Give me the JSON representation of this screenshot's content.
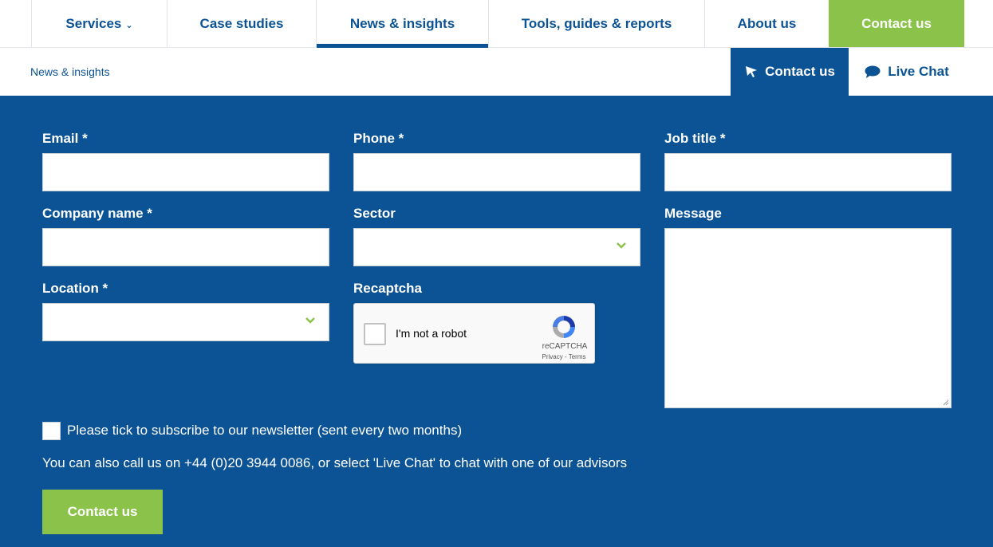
{
  "nav": {
    "items": [
      {
        "label": "Services",
        "has_chevron": true
      },
      {
        "label": "Case studies"
      },
      {
        "label": "News & insights",
        "active": true
      },
      {
        "label": "Tools, guides & reports"
      },
      {
        "label": "About us"
      },
      {
        "label": "Contact us"
      }
    ]
  },
  "subbar": {
    "breadcrumb": "News & insights",
    "contact_label": "Contact us",
    "chat_label": "Live Chat"
  },
  "form": {
    "email_label": "Email *",
    "email_value": "",
    "phone_label": "Phone *",
    "phone_value": "",
    "job_title_label": "Job title *",
    "job_title_value": "",
    "company_label": "Company name *",
    "company_value": "",
    "sector_label": "Sector",
    "sector_value": "",
    "message_label": "Message",
    "message_value": "",
    "location_label": "Location *",
    "location_value": "",
    "recaptcha_label": "Recaptcha",
    "recaptcha": {
      "text": "I'm not a robot",
      "brand": "reCAPTCHA",
      "terms": "Privacy - Terms"
    },
    "newsletter_label": "Please tick to subscribe to our newsletter (sent every two months)",
    "newsletter_checked": false,
    "call_note": "You can also call us on +44 (0)20 3944 0086, or select 'Live Chat' to chat with one of our advisors",
    "submit_label": "Contact us"
  },
  "colors": {
    "brand_blue": "#0b5394",
    "accent_green": "#8bc34a",
    "white": "#ffffff"
  }
}
